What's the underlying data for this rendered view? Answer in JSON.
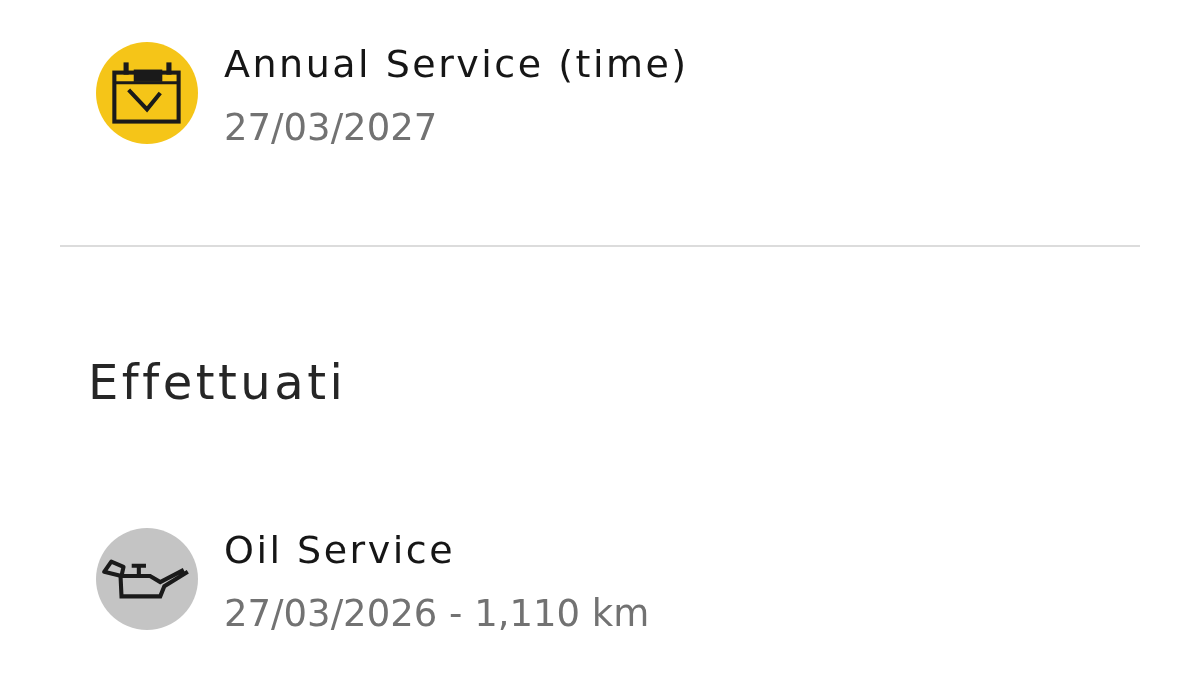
{
  "upcoming": [
    {
      "kind": "calendar",
      "color": "#f5c518",
      "title": "Annual Service (time)",
      "detail": "27/03/2027"
    }
  ],
  "completed": {
    "heading": "Effettuati",
    "items": [
      {
        "kind": "oil",
        "color": "#c4c4c4",
        "title": "Oil Service",
        "detail": "27/03/2026 - 1,110 km"
      }
    ]
  }
}
